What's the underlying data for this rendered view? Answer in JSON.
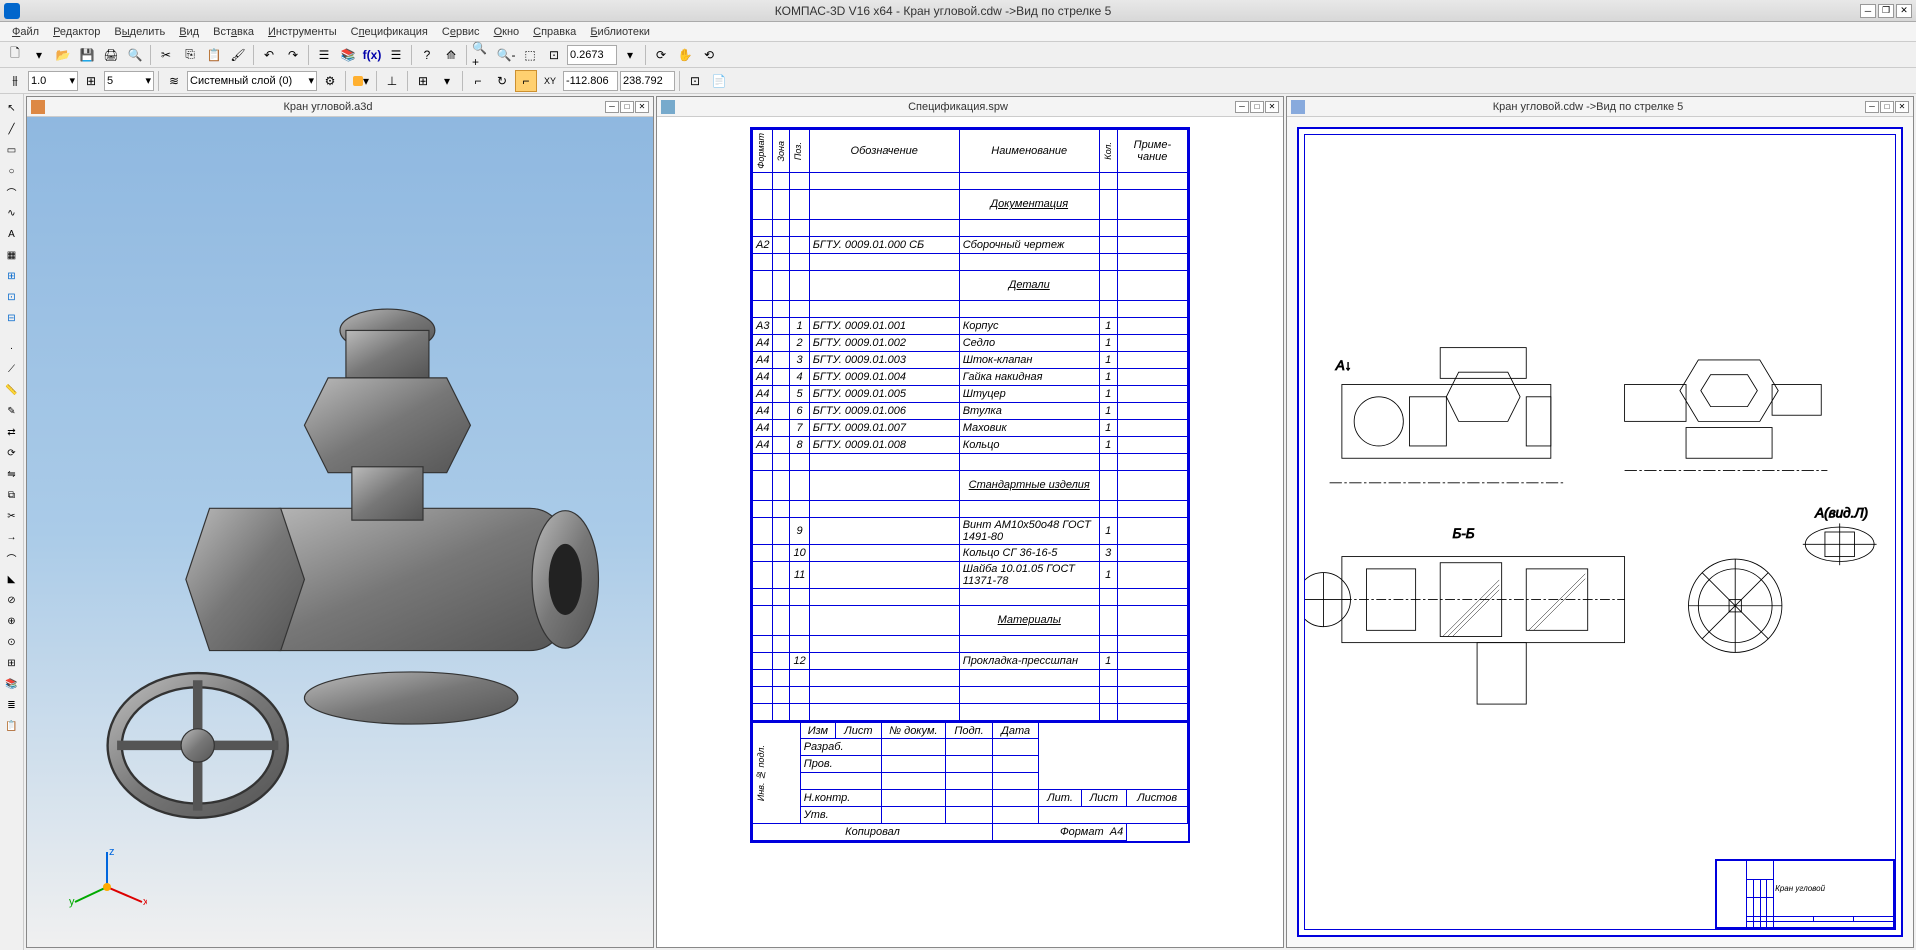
{
  "app": {
    "title": "КОМПАС-3D V16  x64 - Кран угловой.cdw ->Вид по стрелке 5"
  },
  "menu": [
    "Файл",
    "Редактор",
    "Выделить",
    "Вид",
    "Вставка",
    "Инструменты",
    "Спецификация",
    "Сервис",
    "Окно",
    "Справка",
    "Библиотеки"
  ],
  "toolbar1": {
    "zoom_value": "0.2673"
  },
  "toolbar2": {
    "scale": "1.0",
    "step": "5",
    "layer": "Системный слой (0)",
    "coord_x": "-112.806",
    "coord_y": "238.792"
  },
  "panes": {
    "p1_title": "Кран угловой.a3d",
    "p2_title": "Спецификация.spw",
    "p3_title": "Кран угловой.cdw ->Вид по стрелке 5"
  },
  "spec": {
    "headers": {
      "format": "Формат",
      "zone": "Зона",
      "pos": "Поз.",
      "obozn": "Обозначение",
      "naim": "Наименование",
      "kol": "Кол.",
      "prim": "Приме-\nчание"
    },
    "sections": [
      {
        "title": "Документация",
        "rows": [
          {
            "f": "А2",
            "p": "",
            "o": "БГТУ. 0009.01.000 СБ",
            "n": "Сборочный чертеж",
            "k": ""
          }
        ]
      },
      {
        "title": "Детали",
        "rows": [
          {
            "f": "А3",
            "p": "1",
            "o": "БГТУ. 0009.01.001",
            "n": "Корпус",
            "k": "1"
          },
          {
            "f": "А4",
            "p": "2",
            "o": "БГТУ. 0009.01.002",
            "n": "Седло",
            "k": "1"
          },
          {
            "f": "А4",
            "p": "3",
            "o": "БГТУ. 0009.01.003",
            "n": "Шток-клапан",
            "k": "1"
          },
          {
            "f": "А4",
            "p": "4",
            "o": "БГТУ. 0009.01.004",
            "n": "Гайка накидная",
            "k": "1"
          },
          {
            "f": "А4",
            "p": "5",
            "o": "БГТУ. 0009.01.005",
            "n": "Штуцер",
            "k": "1"
          },
          {
            "f": "А4",
            "p": "6",
            "o": "БГТУ. 0009.01.006",
            "n": "Втулка",
            "k": "1"
          },
          {
            "f": "А4",
            "p": "7",
            "o": "БГТУ. 0009.01.007",
            "n": "Маховик",
            "k": "1"
          },
          {
            "f": "А4",
            "p": "8",
            "o": "БГТУ. 0009.01.008",
            "n": "Кольцо",
            "k": "1"
          }
        ]
      },
      {
        "title": "Стандартные изделия",
        "rows": [
          {
            "f": "",
            "p": "9",
            "o": "",
            "n": "Винт АМ10х50о48 ГОСТ 1491-80",
            "k": "1"
          },
          {
            "f": "",
            "p": "10",
            "o": "",
            "n": "Кольцо СГ 36-16-5",
            "k": "3"
          },
          {
            "f": "",
            "p": "11",
            "o": "",
            "n": "Шайба 10.01.05 ГОСТ 11371-78",
            "k": "1"
          }
        ]
      },
      {
        "title": "Материалы",
        "rows": [
          {
            "f": "",
            "p": "12",
            "o": "",
            "n": "Прокладка-прессшпан",
            "k": "1"
          }
        ]
      }
    ],
    "footer": {
      "izm": "Изм",
      "list": "Лист",
      "ndokum": "№ докум.",
      "podp": "Подп.",
      "data": "Дата",
      "razrab": "Разраб.",
      "prov": "Пров.",
      "nkontr": "Н.контр.",
      "utv": "Утв.",
      "lit": "Лит.",
      "listov": "Листов",
      "kopir": "Копировал",
      "format": "Формат",
      "a4": "А4"
    }
  },
  "drawing": {
    "title": "Кран угловой"
  },
  "axes": {
    "x": "x",
    "y": "y",
    "z": "z"
  }
}
